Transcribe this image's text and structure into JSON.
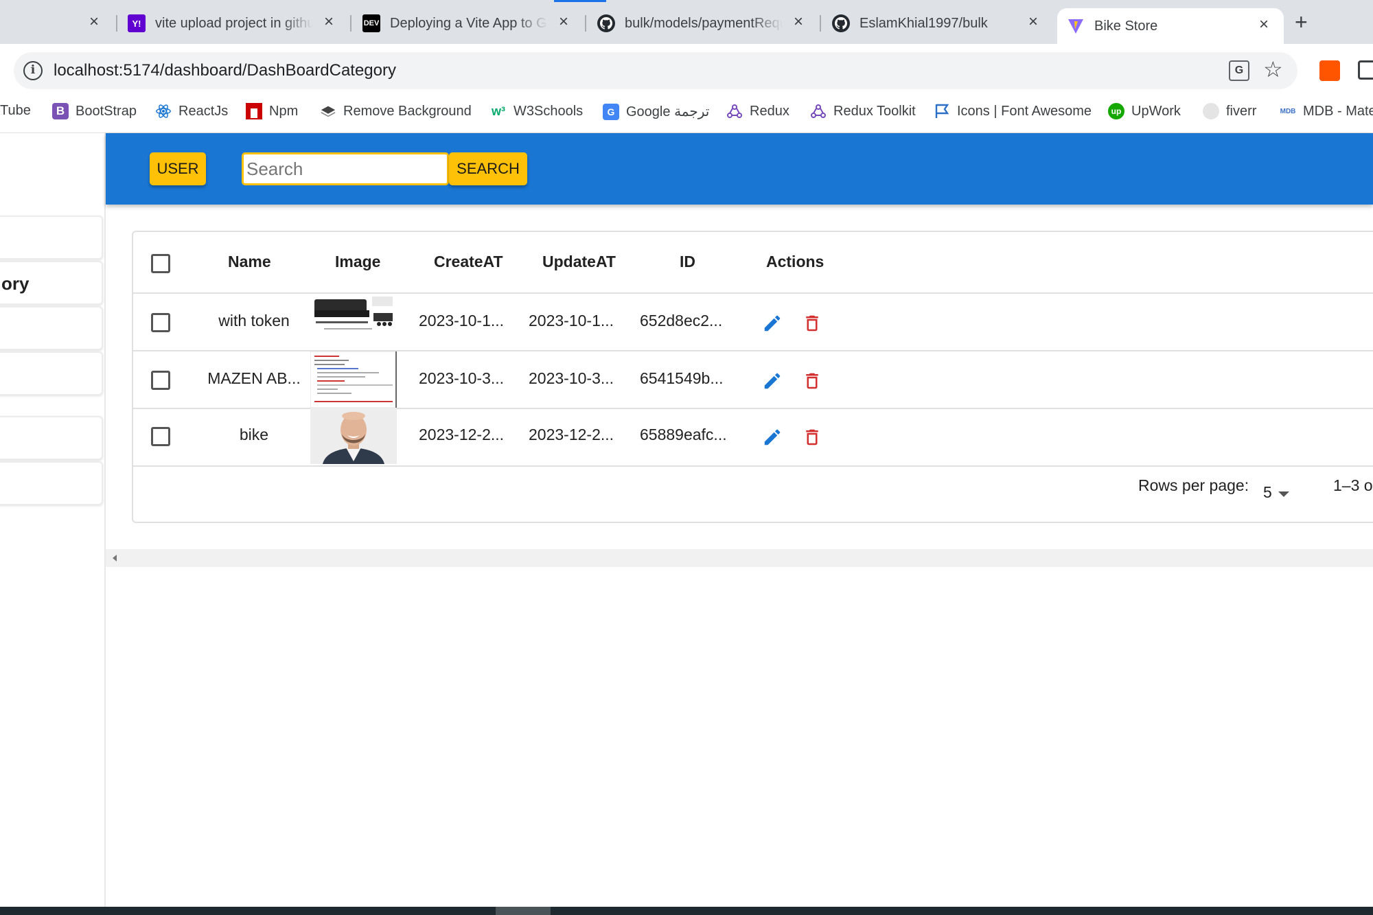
{
  "browser": {
    "tabs": [
      {
        "title": "",
        "favicon": "youtube-icon",
        "close": "×"
      },
      {
        "title": "vite upload project in githu",
        "favicon": "yahoo-icon",
        "close": "×"
      },
      {
        "title": "Deploying a Vite App to Gi",
        "favicon": "dev-icon",
        "close": "×"
      },
      {
        "title": "bulk/models/paymentRequ",
        "favicon": "github-icon",
        "close": "×"
      },
      {
        "title": "EslamKhial1997/bulk",
        "favicon": "github-icon",
        "close": "×"
      },
      {
        "title": "Bike Store",
        "favicon": "vite-icon",
        "close": "×"
      }
    ],
    "new_tab": "+",
    "url": "localhost:5174/dashboard/DashBoardCategory",
    "bookmarks": [
      {
        "label": "Tube",
        "icon": ""
      },
      {
        "label": "BootStrap",
        "icon": "bootstrap-icon"
      },
      {
        "label": "ReactJs",
        "icon": "react-icon"
      },
      {
        "label": "Npm",
        "icon": "npm-icon"
      },
      {
        "label": "Remove Background",
        "icon": "removebg-icon"
      },
      {
        "label": "W3Schools",
        "icon": "w3schools-icon"
      },
      {
        "label": "Google ترجمة",
        "icon": "google-translate-icon"
      },
      {
        "label": "Redux",
        "icon": "redux-icon"
      },
      {
        "label": "Redux Toolkit",
        "icon": "redux-icon"
      },
      {
        "label": "Icons | Font Awesome",
        "icon": "fontawesome-icon"
      },
      {
        "label": "UpWork",
        "icon": "upwork-icon"
      },
      {
        "label": "fiverr",
        "icon": "fiverr-icon"
      },
      {
        "label": "MDB - Mate",
        "icon": "mdb-icon"
      }
    ]
  },
  "sidebar": {
    "items": [
      {
        "label": ""
      },
      {
        "label": "ory"
      },
      {
        "label": ""
      },
      {
        "label": ""
      },
      {
        "label": ""
      },
      {
        "label": ""
      }
    ]
  },
  "appbar": {
    "user_button": "USER",
    "search_placeholder": "Search",
    "search_button": "SEARCH"
  },
  "table": {
    "columns": [
      "Name",
      "Image",
      "CreateAT",
      "UpdateAT",
      "ID",
      "Actions"
    ],
    "rows": [
      {
        "name": "with token",
        "image": "sofa-product-thumbnail",
        "created": "2023-10-1...",
        "updated": "2023-10-1...",
        "id": "652d8ec2..."
      },
      {
        "name": "MAZEN AB...",
        "image": "code-screenshot-thumbnail",
        "created": "2023-10-3...",
        "updated": "2023-10-3...",
        "id": "6541549b..."
      },
      {
        "name": "bike",
        "image": "man-portrait-thumbnail",
        "created": "2023-12-2...",
        "updated": "2023-12-2...",
        "id": "65889eafc..."
      }
    ],
    "footer": {
      "rows_per_page_label": "Rows per page:",
      "rows_per_page_value": "5",
      "pagination": "1–3 o"
    }
  },
  "colors": {
    "appbar": "#1976d2",
    "accent_button": "#ffc107",
    "edit": "#1976d2",
    "delete": "#d32f2f"
  }
}
